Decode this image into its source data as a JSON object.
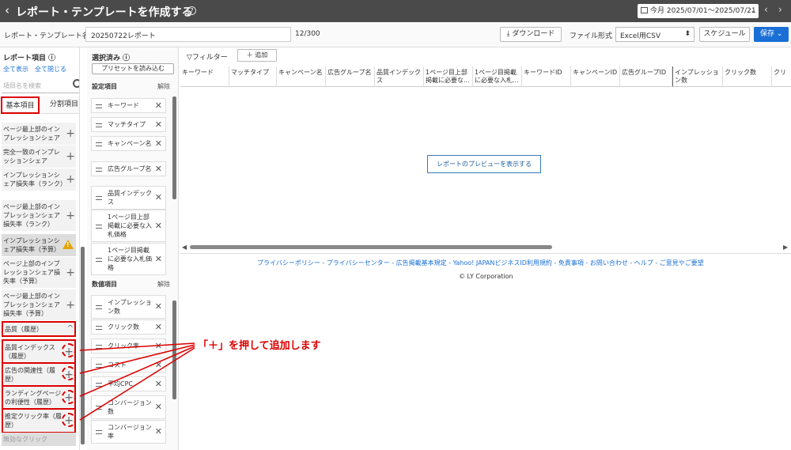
{
  "header": {
    "back": "‹",
    "title": "レポート・テンプレートを作成する",
    "help": "?",
    "date_range": "今月 2025/07/01〜2025/07/21",
    "prev": "‹",
    "next": "›"
  },
  "toolbar": {
    "name_label": "レポート・テンプレート名",
    "name_value": "20250722レポート",
    "char_count": "12/300",
    "download": "ダウンロード",
    "format_label": "ファイル形式",
    "format_value": "Excel用CSV",
    "schedule": "スケジュール",
    "save": "保存"
  },
  "left": {
    "title": "レポート項目",
    "show_all": "全て表示",
    "close_all": "全て閉じる",
    "search_placeholder": "項目名を検索",
    "tab_basic": "基本項目",
    "tab_split": "分割項目",
    "items": [
      "ページ最上部のインプレッションシェア",
      "完全一致のインプレッションシェア",
      "インプレッションシェア損失率（ランク）",
      "ページ最上部のインプレッションシェア損失率（ランク）",
      "インプレッションシェア損失率（予算）",
      "ページ上部のインプレッションシェア損失率（予算）",
      "ページ最上部のインプレッションシェア損失率（予算）"
    ],
    "group": "品質（履歴）",
    "group_items": [
      "品質インデックス（履歴）",
      "広告の関連性（履歴）",
      "ランディングページの利便性（履歴）",
      "推定クリック率（履歴）"
    ],
    "last": "無効なクリック"
  },
  "middle": {
    "title": "選択済み",
    "preset": "プリセットを読み込む",
    "settings": "設定項目",
    "clear": "解除",
    "chips": [
      "キーワード",
      "マッチタイプ",
      "キャンペーン名",
      "広告グループ名",
      "品質インデックス",
      "1ページ目上部掲載に必要な入札価格",
      "1ページ目掲載に必要な入札価格"
    ],
    "metrics": "数値項目",
    "metric_chips": [
      "インプレッション数",
      "クリック数",
      "クリック率",
      "コスト",
      "平均CPC",
      "コンバージョン数",
      "コンバージョン率"
    ]
  },
  "right": {
    "filter": "フィルター",
    "add": "追加",
    "columns": [
      "キーワード",
      "マッチタイプ",
      "キャンペーン名",
      "広告グループ名",
      "品質インデックス",
      "1ページ目上部掲載に必要な...",
      "1ページ目掲載に必要な入札...",
      "キーワードID",
      "キャンペーンID",
      "広告グループID",
      "インプレッション数",
      "クリック数",
      "クリ"
    ],
    "preview": "レポートのプレビューを表示する"
  },
  "footer": {
    "links": "プライバシーポリシー - プライバシーセンター - 広告掲載基本規定 - Yahoo! JAPANビジネスID利用規約 - 免責事項 - お問い合わせ - ヘルプ - ご意見やご要望",
    "copy": "© LY Corporation"
  },
  "annotation": "「＋」を押して追加します"
}
